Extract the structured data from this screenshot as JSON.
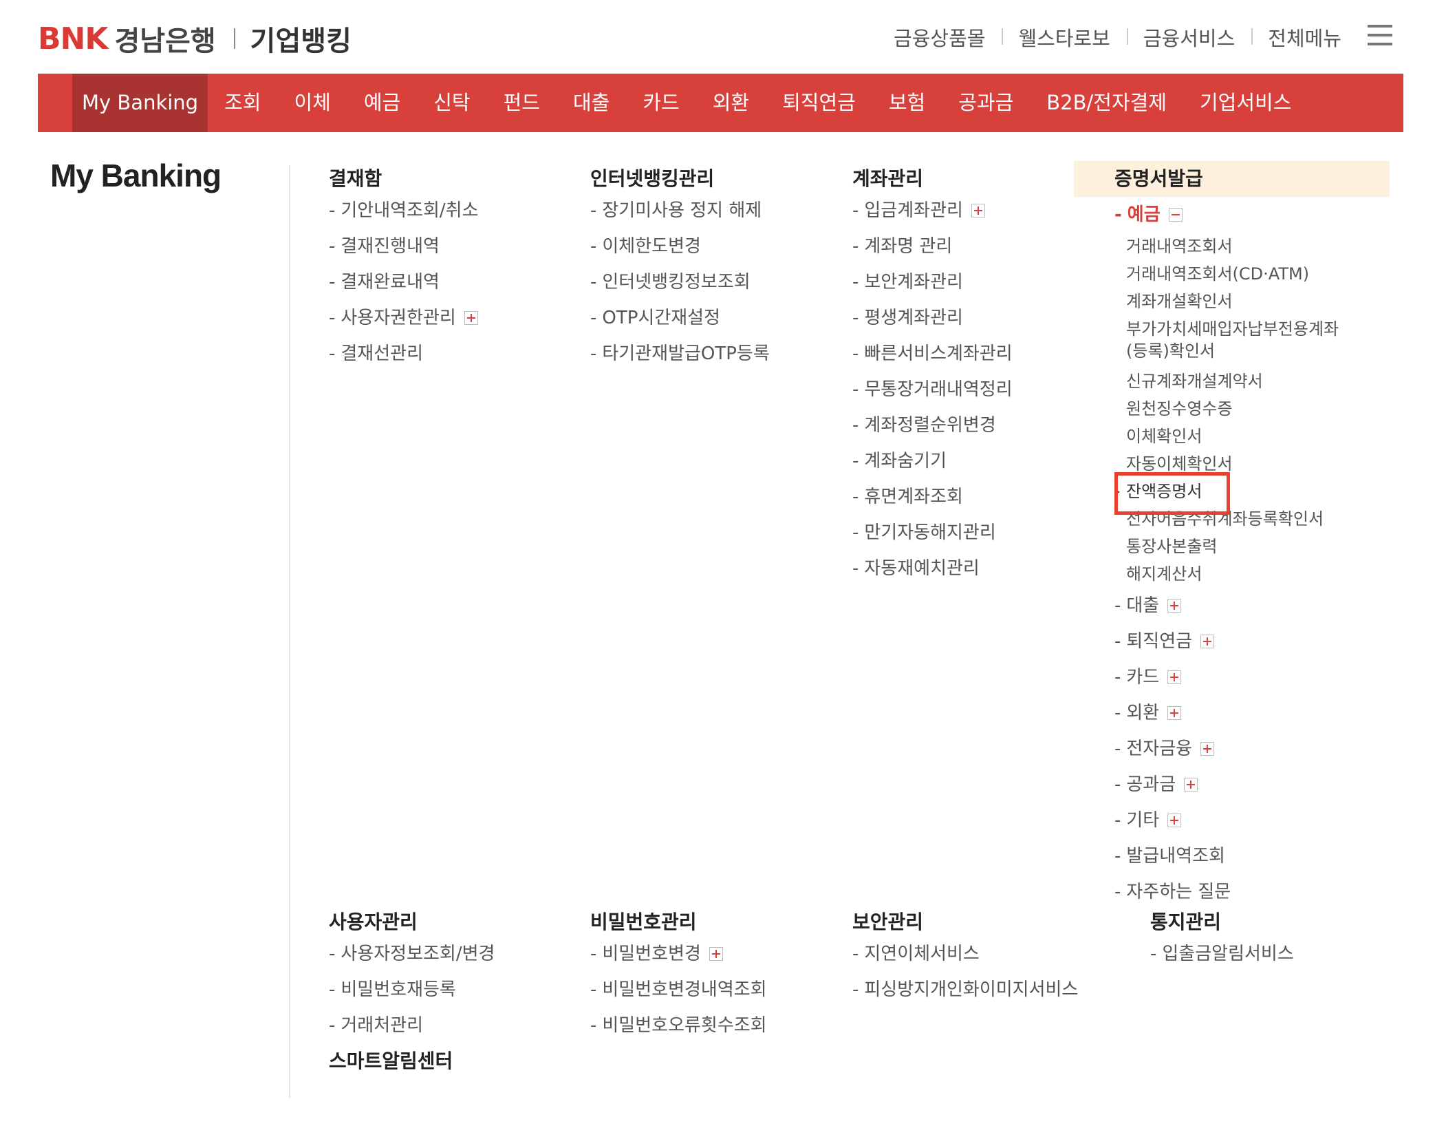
{
  "header": {
    "logo_mark": "BNK",
    "logo_bank": "경남은행",
    "logo_biz": "기업뱅킹",
    "util_links": [
      "금융상품몰",
      "웰스타로보",
      "금융서비스",
      "전체메뉴"
    ],
    "menu_icon": "hamburger-icon"
  },
  "gnb": [
    "My Banking",
    "조회",
    "이체",
    "예금",
    "신탁",
    "펀드",
    "대출",
    "카드",
    "외환",
    "퇴직연금",
    "보험",
    "공과금",
    "B2B/전자결제",
    "기업서비스"
  ],
  "page_title": "My Banking",
  "col1": {
    "title": "결재함",
    "items": [
      "기안내역조회/취소",
      "결재진행내역",
      "결재완료내역",
      "사용자권한관리",
      "결재선관리"
    ]
  },
  "col2": {
    "title": "인터넷뱅킹관리",
    "items": [
      "장기미사용 정지 해제",
      "이체한도변경",
      "인터넷뱅킹정보조회",
      "OTP시간재설정",
      "타기관재발급OTP등록"
    ]
  },
  "col3": {
    "title": "계좌관리",
    "items": [
      "입금계좌관리",
      "계좌명 관리",
      "보안계좌관리",
      "평생계좌관리",
      "빠른서비스계좌관리",
      "무통장거래내역정리",
      "계좌정렬순위변경",
      "계좌숨기기",
      "휴면계좌조회",
      "만기자동해지관리",
      "자동재예치관리"
    ]
  },
  "col4": {
    "title": "증명서발급",
    "open_item": "예금",
    "sub_items": [
      "거래내역조회서",
      "거래내역조회서(CD·ATM)",
      "계좌개설확인서",
      "부가가치세매입자납부전용계좌(등록)확인서",
      "신규계좌개설계약서",
      "원천징수영수증",
      "이체확인서",
      "자동이체확인서",
      "잔액증명서",
      "전자어음수취계좌등록확인서",
      "통장사본출력",
      "해지계산서"
    ],
    "items": [
      "대출",
      "퇴직연금",
      "카드",
      "외환",
      "전자금융",
      "공과금",
      "기타",
      "발급내역조회",
      "자주하는 질문"
    ]
  },
  "col5": {
    "title": "사용자관리",
    "items": [
      "사용자정보조회/변경",
      "비밀번호재등록",
      "거래처관리"
    ],
    "extra_title": "스마트알림센터"
  },
  "col6": {
    "title": "비밀번호관리",
    "items": [
      "비밀번호변경",
      "비밀번호변경내역조회",
      "비밀번호오류횟수조회"
    ]
  },
  "col7": {
    "title": "보안관리",
    "items": [
      "지연이체서비스",
      "피싱방지개인화이미지서비스"
    ]
  },
  "col8": {
    "title": "통지관리",
    "items": [
      "입출금알림서비스"
    ]
  },
  "colors": {
    "brand_red": "#d8403b",
    "active_tab": "#a93330",
    "highlight": "#fdf1dd",
    "annotation_box": "#e8412f"
  }
}
